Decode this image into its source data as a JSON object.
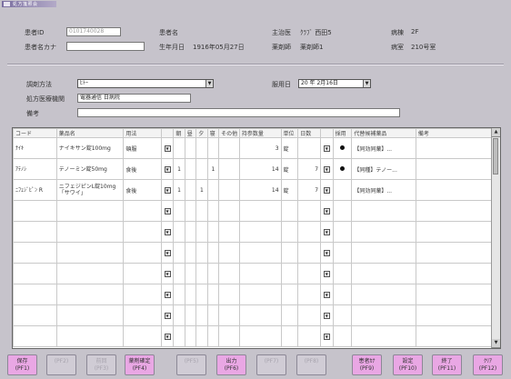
{
  "window": {
    "title": "処方箋照会"
  },
  "patient": {
    "id_label": "患者ID",
    "id_value": "0101740028",
    "kana_label": "患者名カナ",
    "kana_value": "",
    "name_label": "患者名",
    "name_value": "",
    "birth_label": "生年月日",
    "birth_value": "1916年05月27日",
    "dept_label": "主治医",
    "dept_value": "ｸﾗﾌﾞ 西田5",
    "doctor_label": "薬剤師",
    "doctor_value": "薬剤師1",
    "ward_label": "病棟",
    "ward_value": "2F",
    "room_label": "病室",
    "room_value": "210号室"
  },
  "order": {
    "method_label": "調剤方法",
    "method_value": "ﾋﾄｰ",
    "date_label": "服用日",
    "date_value": "20 年 2月16日",
    "facility_label": "処方医療機関",
    "facility_value": "電器通信 日病院",
    "note_label": "備考",
    "note_value": ""
  },
  "grid": {
    "headers": [
      "コード",
      "薬品名",
      "用法",
      "",
      "朝",
      "昼",
      "夕",
      "寝",
      "その他",
      "持参数量",
      "単位",
      "日数",
      "",
      "採用",
      "代替候補薬品",
      "備考"
    ],
    "rows": [
      {
        "code": "ﾅｲｷ",
        "name": "ナイキサン錠100mg",
        "usage": "頓服",
        "m": "",
        "n": "",
        "e": "",
        "b": "",
        "other": "",
        "qty": "3",
        "unit": "錠",
        "days": "",
        "adopt": true,
        "alt": "【同効同薬】...",
        "note": ""
      },
      {
        "code": "ｱﾃﾉｼ",
        "name": "テノーミン錠50mg",
        "usage": "食後",
        "m": "1",
        "n": "",
        "e": "",
        "b": "1",
        "other": "",
        "qty": "14",
        "unit": "錠",
        "days": "7",
        "adopt": true,
        "alt": "【同種】テノー...",
        "note": ""
      },
      {
        "code": "ﾆﾌｪｼﾞﾋﾟﾝ R",
        "name": "ニフェジピンL錠10mg「サワイ」",
        "usage": "食後",
        "m": "1",
        "n": "",
        "e": "1",
        "b": "",
        "other": "",
        "qty": "14",
        "unit": "錠",
        "days": "7",
        "adopt": false,
        "alt": "【同効同薬】...",
        "note": ""
      }
    ],
    "empty_rows": 7
  },
  "fkeys": [
    {
      "label": "保存",
      "key": "(PF1)",
      "enabled": true
    },
    {
      "label": "",
      "key": "(PF2)",
      "enabled": false
    },
    {
      "label": "前回",
      "key": "(PF3)",
      "enabled": false
    },
    {
      "label": "薬剤確定",
      "key": "(PF4)",
      "enabled": true
    },
    {
      "label": "",
      "key": "(PF5)",
      "enabled": false
    },
    {
      "label": "出力",
      "key": "(PF6)",
      "enabled": true
    },
    {
      "label": "",
      "key": "(PF7)",
      "enabled": false
    },
    {
      "label": "",
      "key": "(PF8)",
      "enabled": false
    },
    {
      "label": "患者ｶﾅ",
      "key": "(PF9)",
      "enabled": true
    },
    {
      "label": "設定",
      "key": "(PF10)",
      "enabled": true
    },
    {
      "label": "終了",
      "key": "(PF11)",
      "enabled": true
    },
    {
      "label": "ｸﾘｱ",
      "key": "(PF12)",
      "enabled": true
    }
  ]
}
